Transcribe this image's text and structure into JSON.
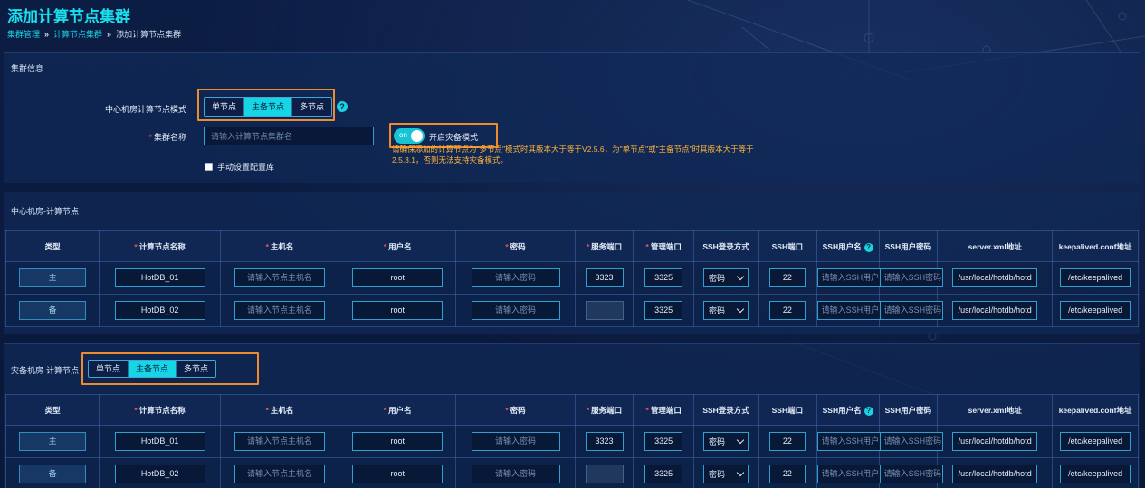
{
  "title": "添加计算节点集群",
  "breadcrumb": [
    "集群管理",
    "计算节点集群",
    "添加计算节点集群"
  ],
  "cluster_info": {
    "section_title": "集群信息",
    "mode_label": "中心机房计算节点模式",
    "modes": [
      "单节点",
      "主备节点",
      "多节点"
    ],
    "active_mode": "主备节点",
    "name_label": "集群名称",
    "name_placeholder": "请输入计算节点集群名",
    "toggle_text": "on",
    "toggle_label": "开启灾备模式",
    "warning_line1": "请确保添加的计算节点为\"多节点\"模式时其版本大于等于V2.5.6，为\"单节点\"或\"主备节点\"时其版本大于等于",
    "warning_line2": "2.5.3.1，否则无法支持灾备模式。",
    "checkbox_label": "手动设置配置库"
  },
  "columns": [
    "类型",
    "计算节点名称",
    "主机名",
    "用户名",
    "密码",
    "服务端口",
    "管理端口",
    "SSH登录方式",
    "SSH端口",
    "SSH用户名",
    "SSH用户密码",
    "server.xml地址",
    "keepalived.conf地址"
  ],
  "center": {
    "section_title": "中心机房-计算节点",
    "rows": [
      {
        "type": "主",
        "name": "HotDB_01",
        "host_ph": "请输入节点主机名",
        "user": "root",
        "pwd_ph": "请输入密码",
        "service_port": "3323",
        "manage_port": "3325",
        "ssh_method": "密码",
        "ssh_port": "22",
        "ssh_user_ph": "请输入SSH用户",
        "ssh_pwd_ph": "请输入SSH密码",
        "server_xml": "/usr/local/hotdb/hotd",
        "keepalived": "/etc/keepalived"
      },
      {
        "type": "备",
        "name": "HotDB_02",
        "host_ph": "请输入节点主机名",
        "user": "root",
        "pwd_ph": "请输入密码",
        "service_port": "",
        "manage_port": "3325",
        "ssh_method": "密码",
        "ssh_port": "22",
        "ssh_user_ph": "请输入SSH用户",
        "ssh_pwd_ph": "请输入SSH密码",
        "server_xml": "/usr/local/hotdb/hotd",
        "keepalived": "/etc/keepalived"
      }
    ]
  },
  "dr": {
    "section_title": "灾备机房-计算节点",
    "modes": [
      "单节点",
      "主备节点",
      "多节点"
    ],
    "active_mode": "主备节点",
    "rows": [
      {
        "type": "主",
        "name": "HotDB_01",
        "host_ph": "请输入节点主机名",
        "user": "root",
        "pwd_ph": "请输入密码",
        "service_port": "3323",
        "manage_port": "3325",
        "ssh_method": "密码",
        "ssh_port": "22",
        "ssh_user_ph": "请输入SSH用户",
        "ssh_pwd_ph": "请输入SSH密码",
        "server_xml": "/usr/local/hotdb/hotd",
        "keepalived": "/etc/keepalived"
      },
      {
        "type": "备",
        "name": "HotDB_02",
        "host_ph": "请输入节点主机名",
        "user": "root",
        "pwd_ph": "请输入密码",
        "service_port": "",
        "manage_port": "3325",
        "ssh_method": "密码",
        "ssh_port": "22",
        "ssh_user_ph": "请输入SSH用户",
        "ssh_pwd_ph": "请输入SSH密码",
        "server_xml": "/usr/local/hotdb/hotd",
        "keepalived": "/etc/keepalived"
      }
    ]
  },
  "colors": {
    "accent": "#16d6e6",
    "highlight": "#f08a2e",
    "required": "#ff4d4f",
    "warning": "#ffb33a"
  }
}
